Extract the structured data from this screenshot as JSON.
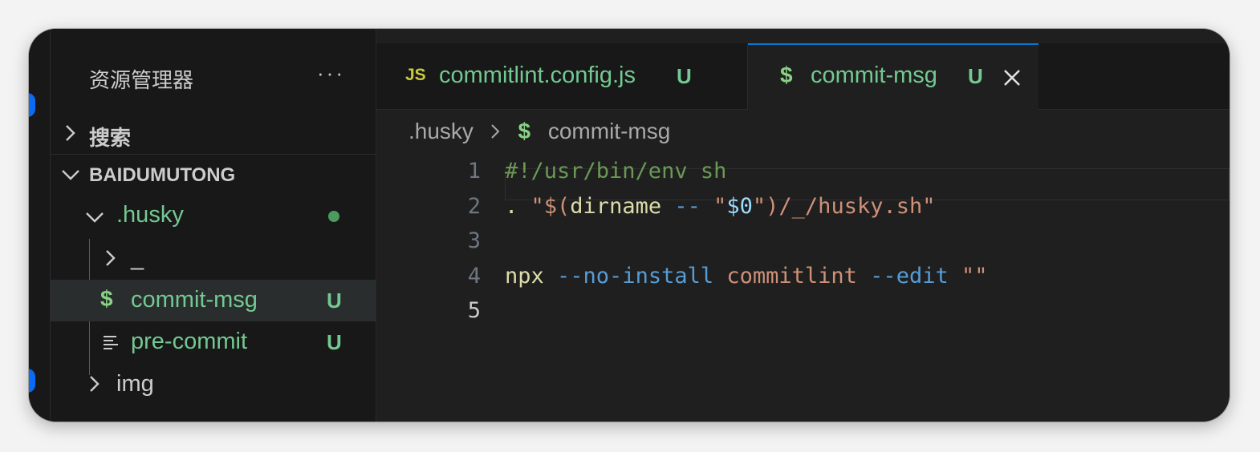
{
  "explorer": {
    "title": "资源管理器",
    "more": "···",
    "search_section": "搜索",
    "workspace": "BAIDUMUTONG",
    "tree": [
      {
        "label": ".husky",
        "kind": "folder-open",
        "badge": ""
      },
      {
        "label": "_",
        "kind": "folder",
        "badge": ""
      },
      {
        "label": "commit-msg",
        "kind": "shell",
        "icon": "$",
        "badge": "U",
        "selected": true
      },
      {
        "label": "pre-commit",
        "kind": "file",
        "badge": "U"
      },
      {
        "label": "img",
        "kind": "folder",
        "badge": ""
      }
    ]
  },
  "tabs": [
    {
      "icon": "JS",
      "label": "commitlint.config.js",
      "badge": "U"
    },
    {
      "icon": "$",
      "label": "commit-msg",
      "badge": "U",
      "close": "×",
      "active": true
    }
  ],
  "breadcrumb": {
    "folder": ".husky",
    "file_icon": "$",
    "file": "commit-msg"
  },
  "code": {
    "line_numbers": [
      "1",
      "2",
      "3",
      "4",
      "5"
    ],
    "active_line": "5",
    "lines": [
      [
        {
          "t": "#!/usr/bin/env sh",
          "c": "#6a9955"
        }
      ],
      [
        {
          "t": ". ",
          "c": "#dcdcaa"
        },
        {
          "t": "\"$(",
          "c": "#ce9178"
        },
        {
          "t": "dirname",
          "c": "#dcdcaa"
        },
        {
          "t": " -- ",
          "c": "#569cd6"
        },
        {
          "t": "\"",
          "c": "#ce9178"
        },
        {
          "t": "$0",
          "c": "#9cdcfe"
        },
        {
          "t": "\")/_/husky.sh\"",
          "c": "#ce9178"
        }
      ],
      [],
      [
        {
          "t": "npx",
          "c": "#dcdcaa"
        },
        {
          "t": " --no-install ",
          "c": "#569cd6"
        },
        {
          "t": "commitlint",
          "c": "#ce9178"
        },
        {
          "t": " --edit ",
          "c": "#569cd6"
        },
        {
          "t": "\"\"",
          "c": "#ce9178"
        }
      ],
      []
    ]
  },
  "colors": {
    "accent": "#0078d4",
    "git_untracked": "#73c991",
    "js_icon": "#cbcb41",
    "shell_icon": "#89d185"
  }
}
